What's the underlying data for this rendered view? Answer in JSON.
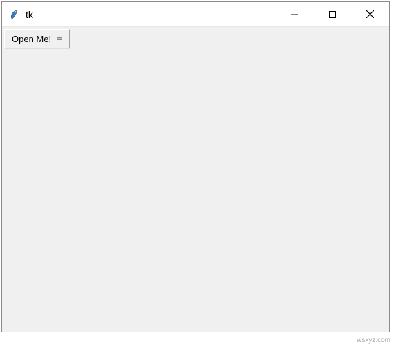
{
  "window": {
    "title": "tk"
  },
  "content": {
    "menu_button_label": "Open Me!"
  },
  "watermark": "wsxyz.com"
}
